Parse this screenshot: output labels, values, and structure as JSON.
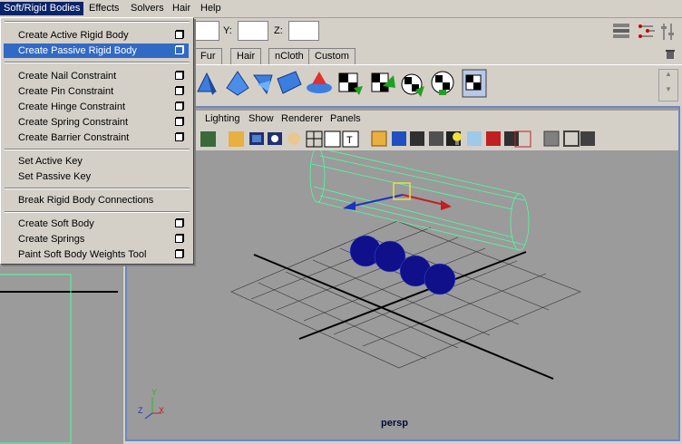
{
  "menubar": {
    "items": [
      "Soft/Rigid Bodies",
      "Effects",
      "Solvers",
      "Hair",
      "Help"
    ]
  },
  "status": {
    "y_label": "Y:",
    "z_label": "Z:"
  },
  "shelf": {
    "tabs": [
      "Fur",
      "Hair",
      "nCloth",
      "Custom"
    ]
  },
  "panel": {
    "menu": [
      "Lighting",
      "Show",
      "Renderer",
      "Panels"
    ],
    "view_name": "persp",
    "axes": {
      "y": "Y",
      "z": "Z",
      "x": "X"
    }
  },
  "dropdown": {
    "items": [
      {
        "label": "Create Active Rigid Body",
        "option": true
      },
      {
        "label": "Create Passive Rigid Body",
        "option": true
      },
      {
        "label": "Create Nail Constraint",
        "option": true
      },
      {
        "label": "Create Pin Constraint",
        "option": true
      },
      {
        "label": "Create Hinge Constraint",
        "option": true
      },
      {
        "label": "Create Spring Constraint",
        "option": true
      },
      {
        "label": "Create Barrier Constraint",
        "option": true
      },
      {
        "label": "Set Active Key",
        "option": false
      },
      {
        "label": "Set Passive Key",
        "option": false
      },
      {
        "label": "Break Rigid Body Connections",
        "option": false
      },
      {
        "label": "Create Soft Body",
        "option": true
      },
      {
        "label": "Create Springs",
        "option": true
      },
      {
        "label": "Paint Soft Body Weights Tool",
        "option": true
      }
    ]
  },
  "colors": {
    "menu_highlight": "#316ac5",
    "menubar_active": "#0a246a",
    "wire_green": "#4dffa0",
    "sphere_blue": "#10108a",
    "panel_border": "#6b86c2"
  }
}
